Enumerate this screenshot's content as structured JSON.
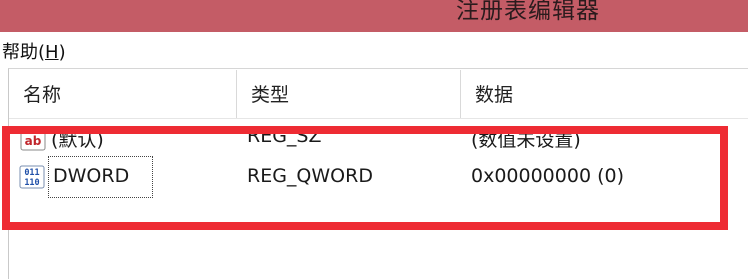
{
  "window": {
    "title": "注册表编辑器"
  },
  "menu": [
    {
      "label": "帮助(",
      "mnemonic": "H",
      "suffix": ")"
    }
  ],
  "columns": [
    "名称",
    "类型",
    "数据"
  ],
  "rows": [
    {
      "name": "(默认)",
      "type": "REG_SZ",
      "data": "(数值未设置)",
      "icon": "registry-string-value-icon",
      "icon_text": "ab"
    },
    {
      "name": "DWORD",
      "type": "REG_QWORD",
      "data": "0x00000000 (0)",
      "icon": "registry-binary-value-icon",
      "icon_text": [
        "011",
        "110"
      ]
    }
  ],
  "colors": {
    "titlebar": "#c45c66",
    "highlight_box": "#ee2b33"
  }
}
